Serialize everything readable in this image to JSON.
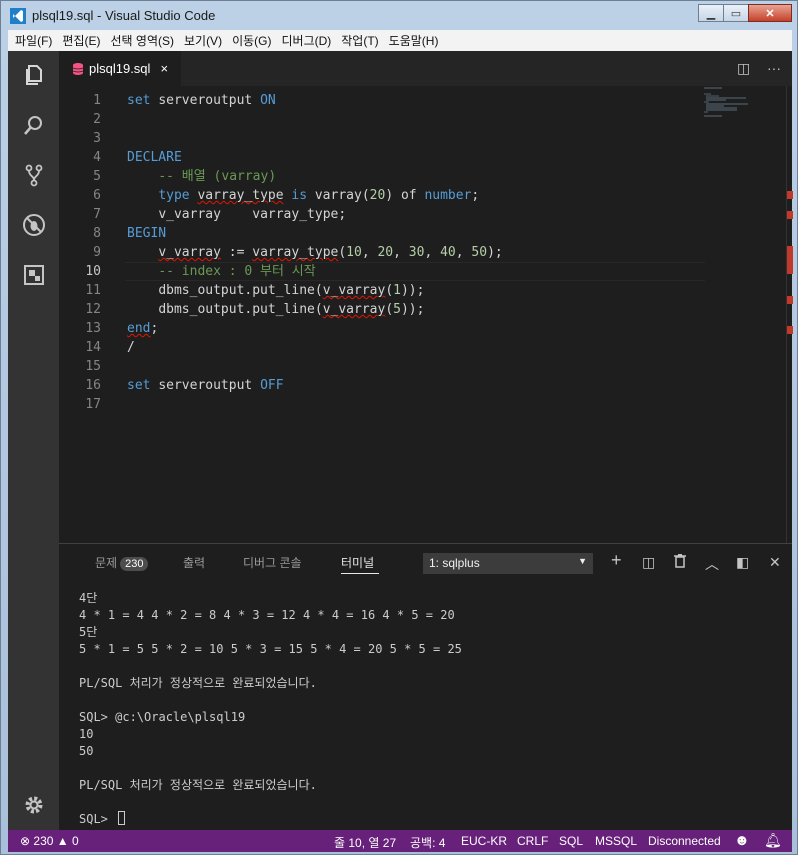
{
  "window": {
    "title": "plsql19.sql - Visual Studio Code",
    "controls": [
      "minimize-icon",
      "maximize-icon",
      "close-icon"
    ]
  },
  "menu": [
    "파일(F)",
    "편집(E)",
    "선택 영역(S)",
    "보기(V)",
    "이동(G)",
    "디버그(D)",
    "작업(T)",
    "도움말(H)"
  ],
  "activity_bar": [
    "explorer-icon",
    "search-icon",
    "source-control-icon",
    "debug-icon",
    "extensions-icon",
    "settings-gear-icon"
  ],
  "editor": {
    "tab": {
      "label": "plsql19.sql",
      "close": "×"
    },
    "actions": [
      "split-editor-icon",
      "more-actions-icon"
    ],
    "active_line": 10,
    "line_numbers": [
      "1",
      "2",
      "3",
      "4",
      "5",
      "6",
      "7",
      "8",
      "9",
      "10",
      "11",
      "12",
      "13",
      "14",
      "15",
      "16",
      "17"
    ],
    "lines": [
      "set serveroutput ON",
      "",
      "",
      "DECLARE",
      "    -- 배열 (varray)",
      "    type varray_type is varray(20) of number;",
      "    v_varray    varray_type;",
      "BEGIN",
      "    v_varray := varray_type(10, 20, 30, 40, 50);",
      "    -- index : 0 부터 시작",
      "    dbms_output.put_line(v_varray(1));",
      "    dbms_output.put_line(v_varray(5));",
      "end;",
      "/",
      "",
      "set serveroutput OFF",
      ""
    ]
  },
  "panel": {
    "tabs": [
      {
        "label": "문제",
        "badge": "230"
      },
      {
        "label": "출력"
      },
      {
        "label": "디버그 콘솔"
      },
      {
        "label": "터미널"
      }
    ],
    "terminal_select": "1: sqlplus",
    "actions": [
      "add-terminal-icon",
      "split-terminal-icon",
      "trash-icon",
      "chevron-up-icon",
      "toggle-panel-icon",
      "close-panel-icon"
    ],
    "terminal_lines": [
      "4단",
      "4 * 1 = 4 4 * 2 = 8 4 * 3 = 12 4 * 4 = 16 4 * 5 = 20",
      "5단",
      "5 * 1 = 5 5 * 2 = 10 5 * 3 = 15 5 * 4 = 20 5 * 5 = 25",
      "",
      "PL/SQL 처리가 정상적으로 완료되었습니다.",
      "",
      "SQL> @c:\\Oracle\\plsql19",
      "10",
      "50",
      "",
      "PL/SQL 처리가 정상적으로 완료되었습니다.",
      "",
      "SQL> "
    ]
  },
  "statusbar": {
    "errors": "230",
    "warnings": "0",
    "position": "줄 10, 열 27",
    "indent": "공백: 4",
    "encoding": "EUC-KR",
    "eol": "CRLF",
    "language": "SQL",
    "connection_type": "MSSQL",
    "connection_status": "Disconnected"
  },
  "colors": {
    "statusbar": "#68217a",
    "keyword": "#569cd6",
    "comment": "#6a9955",
    "number": "#b5cea8",
    "error_squiggle": "#e51400"
  }
}
